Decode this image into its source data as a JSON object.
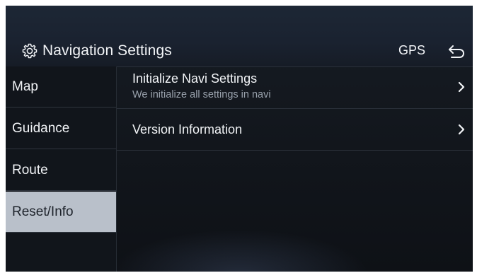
{
  "header": {
    "title": "Navigation Settings",
    "gps_label": "GPS",
    "icons": {
      "settings": "gear-icon",
      "back": "back-arrow-icon"
    }
  },
  "sidebar": {
    "items": [
      {
        "label": "Map",
        "active": false
      },
      {
        "label": "Guidance",
        "active": false
      },
      {
        "label": "Route",
        "active": false
      },
      {
        "label": "Reset/Info",
        "active": true
      }
    ]
  },
  "content": {
    "rows": [
      {
        "title": "Initialize Navi Settings",
        "subtitle": "We initialize all settings in navi",
        "icon": "chevron-right-icon"
      },
      {
        "title": "Version Information",
        "icon": "chevron-right-icon"
      }
    ]
  },
  "colors": {
    "background": "#12161c",
    "active_tab": "#b9c0ca",
    "text": "#f2f4f7",
    "subtext": "#9aa2ad"
  }
}
